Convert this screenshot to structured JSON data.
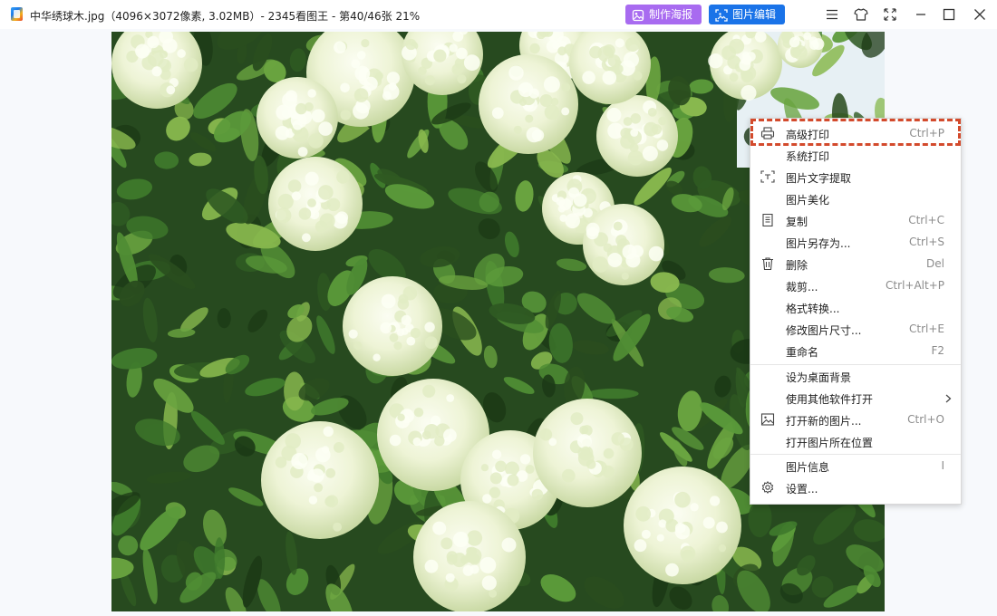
{
  "window": {
    "title": "中华绣球木.jpg（4096×3072像素, 3.02MB）- 2345看图王 - 第40/46张 21%",
    "toolbar": {
      "poster_label": "制作海报",
      "edit_label": "图片编辑"
    },
    "controls": [
      "menu-icon",
      "skin-icon",
      "fullscreen-icon",
      "minimize-icon",
      "maximize-icon",
      "close-icon"
    ]
  },
  "viewer": {
    "image_file": "中华绣球木.jpg",
    "image_subject": "white viburnum flower clusters among green leaves"
  },
  "context_menu": {
    "items": [
      {
        "label": "高级打印",
        "shortcut": "Ctrl+P",
        "icon": "printer-icon",
        "highlighted": true
      },
      {
        "label": "系统打印",
        "shortcut": "",
        "icon": ""
      },
      {
        "label": "图片文字提取",
        "shortcut": "",
        "icon": "ocr-scan-icon"
      },
      {
        "label": "图片美化",
        "shortcut": "",
        "icon": ""
      },
      {
        "label": "复制",
        "shortcut": "Ctrl+C",
        "icon": "copy-icon"
      },
      {
        "label": "图片另存为...",
        "shortcut": "Ctrl+S",
        "icon": ""
      },
      {
        "label": "删除",
        "shortcut": "Del",
        "icon": "trash-icon"
      },
      {
        "label": "裁剪...",
        "shortcut": "Ctrl+Alt+P",
        "icon": ""
      },
      {
        "label": "格式转换...",
        "shortcut": "",
        "icon": ""
      },
      {
        "label": "修改图片尺寸...",
        "shortcut": "Ctrl+E",
        "icon": ""
      },
      {
        "label": "重命名",
        "shortcut": "F2",
        "icon": ""
      },
      {
        "label": "设为桌面背景",
        "shortcut": "",
        "icon": ""
      },
      {
        "label": "使用其他软件打开",
        "shortcut": "",
        "icon": "",
        "submenu": true
      },
      {
        "label": "打开新的图片...",
        "shortcut": "Ctrl+O",
        "icon": "image-icon"
      },
      {
        "label": "打开图片所在位置",
        "shortcut": "",
        "icon": ""
      },
      {
        "label": "图片信息",
        "shortcut": "I",
        "icon": ""
      },
      {
        "label": "设置...",
        "shortcut": "",
        "icon": "gear-icon"
      }
    ]
  },
  "colors": {
    "poster_button": "#a86bf0",
    "edit_button": "#1a73e8",
    "highlight_dashed": "#d34a2c",
    "viewer_background": "#f7f9fc"
  }
}
